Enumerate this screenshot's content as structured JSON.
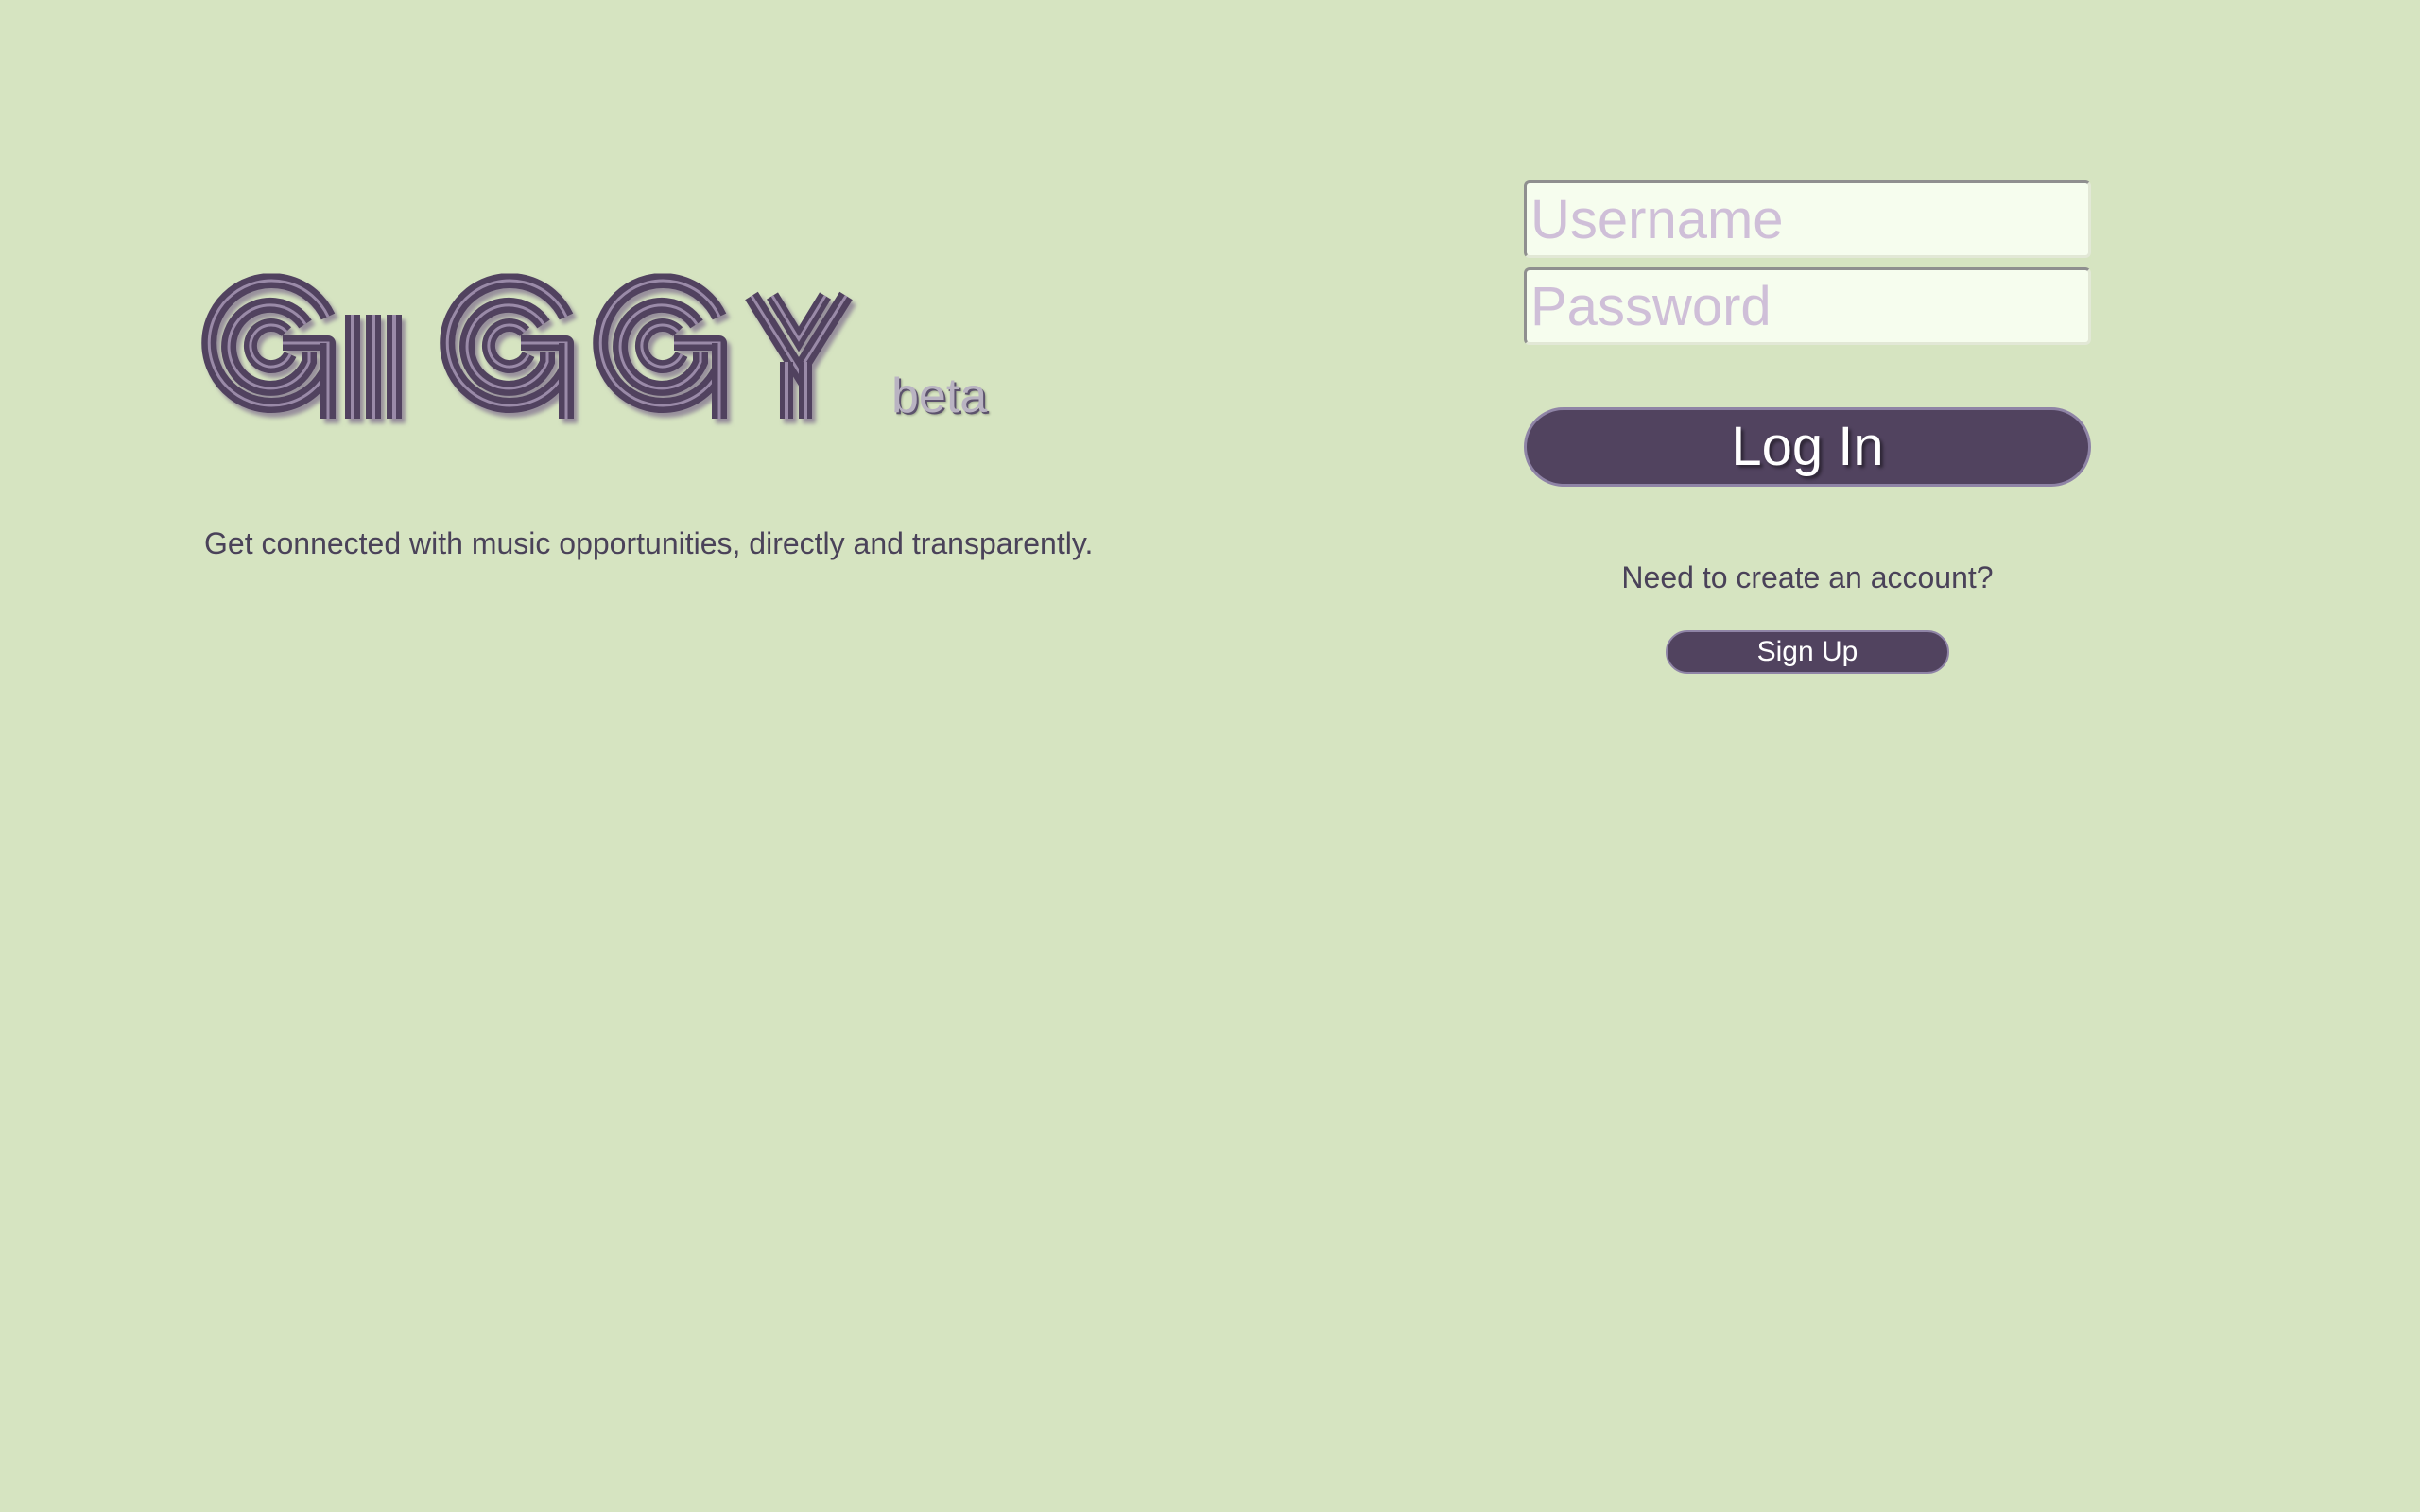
{
  "brand": {
    "logo_text": "GIGGY",
    "badge": "beta",
    "tagline": "Get connected with music opportunities, directly and transparently."
  },
  "login_form": {
    "username_placeholder": "Username",
    "password_placeholder": "Password",
    "login_label": "Log In"
  },
  "signup": {
    "prompt": "Need to create an account?",
    "button_label": "Sign Up"
  },
  "colors": {
    "background": "#d6e4c1",
    "primary": "#51435f",
    "placeholder": "#cfbfd8",
    "input_background": "#f6fdee",
    "text": "#4a4259"
  }
}
